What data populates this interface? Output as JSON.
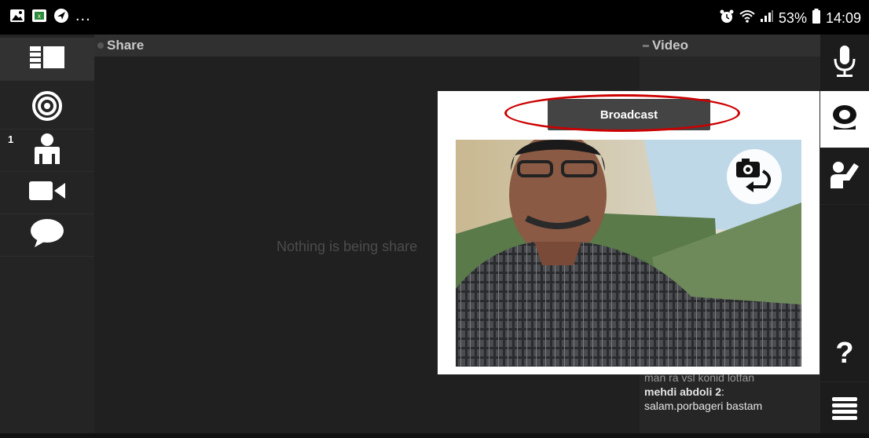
{
  "status_bar": {
    "battery": "53%",
    "time": "14:09",
    "more": "..."
  },
  "share_panel": {
    "title": "Share",
    "empty_message": "Nothing is being share"
  },
  "video_panel": {
    "title": "Video"
  },
  "left_sidebar": {
    "users_badge": "1"
  },
  "chat": {
    "partial_line": "man ra vsl konid lotfan",
    "sender": "mehdi abdoli 2",
    "message": "salam.porbageri bastam"
  },
  "broadcast_popup": {
    "button_label": "Broadcast"
  },
  "right_sidebar": {
    "help_label": "?"
  },
  "colors": {
    "background": "#202020",
    "header": "#303030",
    "highlight_ring": "#cc0000",
    "button": "#444444"
  }
}
